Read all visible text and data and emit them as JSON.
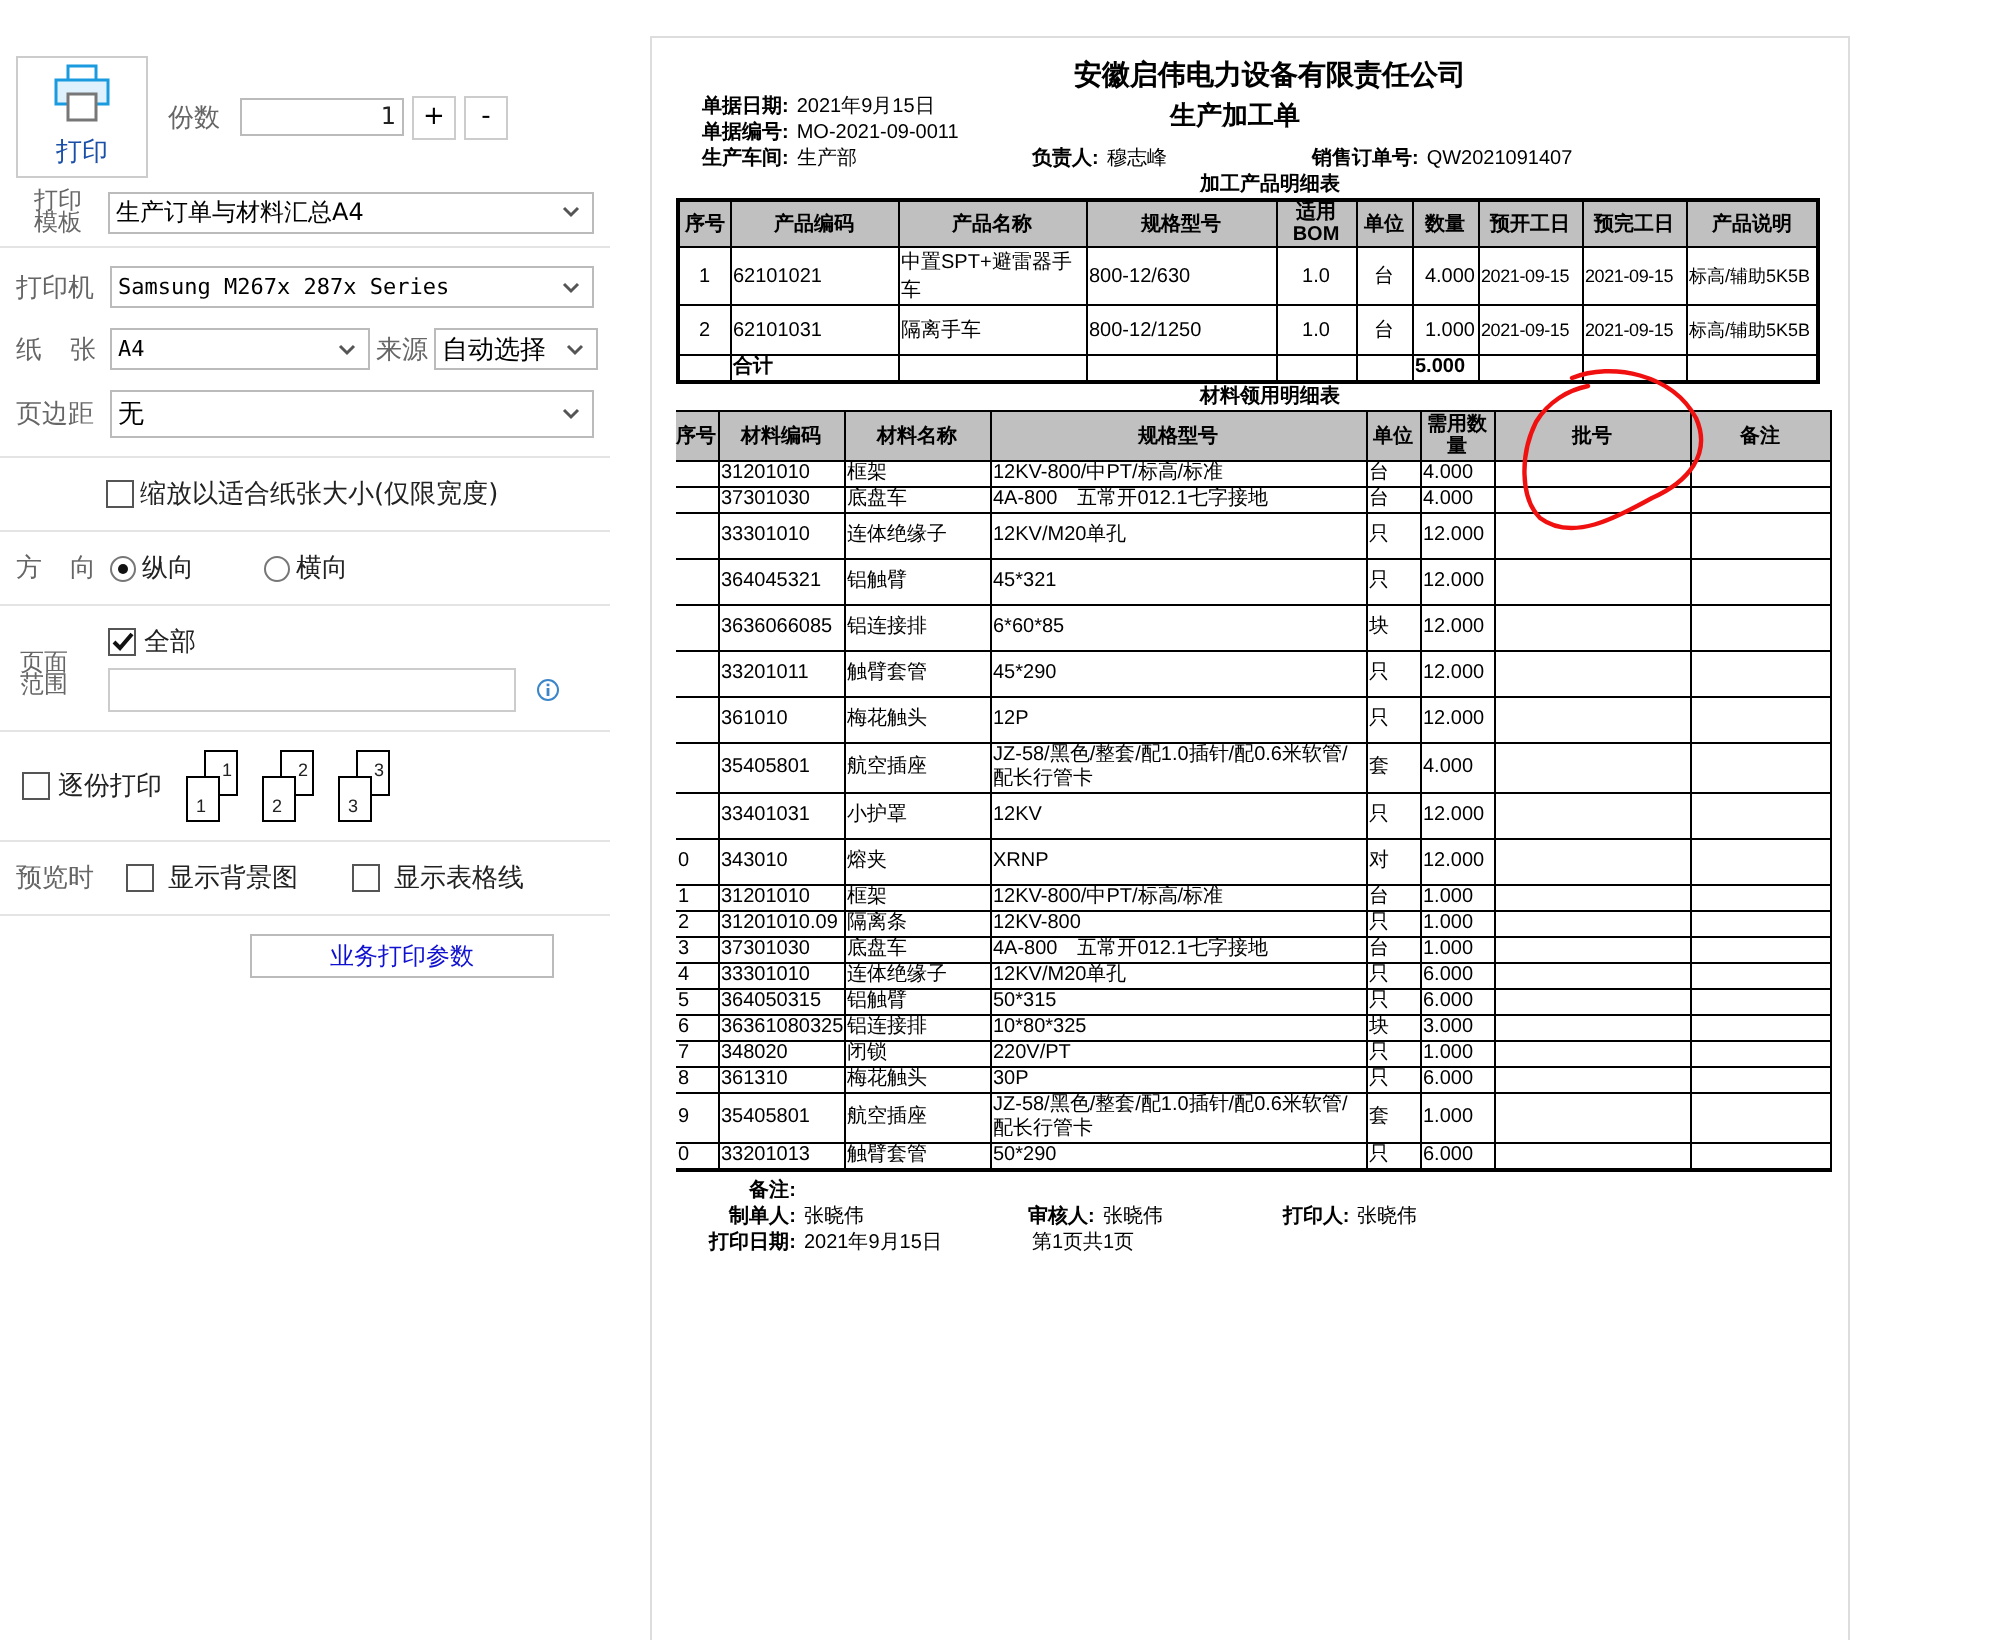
{
  "left_panel": {
    "print_button": {
      "label": "打印"
    },
    "copies": {
      "label": "份数",
      "value": "1",
      "plus": "+",
      "minus": "-"
    },
    "template": {
      "label": "打印模板",
      "value": "生产订单与材料汇总A4"
    },
    "printer": {
      "label": "打印机",
      "value": "Samsung M267x 287x Series"
    },
    "paper": {
      "label": "纸 张",
      "value": "A4",
      "source_label": "来源",
      "source_value": "自动选择"
    },
    "margin": {
      "label": "页边距",
      "value": "无"
    },
    "fit": {
      "label": "缩放以适合纸张大小(仅限宽度)",
      "checked": false
    },
    "orientation": {
      "label": "方 向",
      "options": [
        {
          "label": "纵向",
          "selected": true
        },
        {
          "label": "横向",
          "selected": false
        }
      ]
    },
    "page_range": {
      "label": "页面范围",
      "all": {
        "label": "全部",
        "checked": true
      }
    },
    "collate": {
      "label": "逐份打印",
      "checked": false,
      "stacks": [
        {
          "back": "1",
          "front": "1"
        },
        {
          "back": "2",
          "front": "2"
        },
        {
          "back": "3",
          "front": "3"
        }
      ]
    },
    "preview": {
      "label": "预览时",
      "options": [
        {
          "label": "显示背景图",
          "checked": false
        },
        {
          "label": "显示表格线",
          "checked": false
        }
      ]
    },
    "params_button": "业务打印参数"
  },
  "document": {
    "company": "安徽启伟电力设备有限责任公司",
    "title": "生产加工单",
    "info": [
      {
        "label": "单据日期:",
        "value": "2021年9月15日"
      },
      {
        "label": "单据编号:",
        "value": "MO-2021-09-0011"
      },
      {
        "label": "生产车间:",
        "value": "生产部"
      },
      {
        "label": "负责人:",
        "value": "穆志峰"
      },
      {
        "label": "销售订单号:",
        "value": "QW2021091407"
      }
    ],
    "product_table": {
      "title": "加工产品明细表",
      "columns": [
        "序号",
        "产品编码",
        "产品名称",
        "规格型号",
        "适用BOM",
        "单位",
        "数量",
        "预开工日",
        "预完工日",
        "产品说明"
      ],
      "rows": [
        [
          "1",
          "62101021",
          "中置SPT+避雷器手车",
          "800-12/630",
          "1.0",
          "台",
          "4.000",
          "2021-09-15",
          "2021-09-15",
          "标高/辅助5K5B"
        ],
        [
          "2",
          "62101031",
          "隔离手车",
          "800-12/1250",
          "1.0",
          "台",
          "1.000",
          "2021-09-15",
          "2021-09-15",
          "标高/辅助5K5B"
        ]
      ],
      "total": {
        "label": "合计",
        "quantity": "5.000"
      }
    },
    "material_table": {
      "title": "材料领用明细表",
      "columns": [
        "序号",
        "材料编码",
        "材料名称",
        "规格型号",
        "单位",
        "需用数量",
        "批号",
        "备注"
      ],
      "rows": [
        {
          "code": "31201010",
          "name": "框架",
          "spec": "12KV-800/中PT/标高/标准",
          "unit": "台",
          "qty": "4.000"
        },
        {
          "code": "37301030",
          "name": "底盘车",
          "spec": "4A-800　五常开012.1七字接地",
          "unit": "台",
          "qty": "4.000"
        },
        {
          "code": "33301010",
          "name": "连体绝缘子",
          "spec": "12KV/M20单孔",
          "unit": "只",
          "qty": "12.000"
        },
        {
          "code": "364045321",
          "name": "铝触臂",
          "spec": "45*321",
          "unit": "只",
          "qty": "12.000"
        },
        {
          "code": "3636066085",
          "name": "铝连接排",
          "spec": "6*60*85",
          "unit": "块",
          "qty": "12.000"
        },
        {
          "code": "33201011",
          "name": "触臂套管",
          "spec": "45*290",
          "unit": "只",
          "qty": "12.000"
        },
        {
          "code": "361010",
          "name": "梅花触头",
          "spec": "12P",
          "unit": "只",
          "qty": "12.000"
        },
        {
          "code": "35405801",
          "name": "航空插座",
          "spec": "JZ-58/黑色/整套/配1.0插针/配0.6米软管/配长行管卡",
          "unit": "套",
          "qty": "4.000"
        },
        {
          "code": "33401031",
          "name": "小护罩",
          "spec": "12KV",
          "unit": "只",
          "qty": "12.000"
        },
        {
          "seq": "0",
          "code": "343010",
          "name": "熔夹",
          "spec": "XRNP",
          "unit": "对",
          "qty": "12.000"
        },
        {
          "seq": "1",
          "code": "31201010",
          "name": "框架",
          "spec": "12KV-800/中PT/标高/标准",
          "unit": "台",
          "qty": "1.000"
        },
        {
          "seq": "2",
          "code": "31201010.09",
          "name": "隔离条",
          "spec": "12KV-800",
          "unit": "只",
          "qty": "1.000"
        },
        {
          "seq": "3",
          "code": "37301030",
          "name": "底盘车",
          "spec": "4A-800　五常开012.1七字接地",
          "unit": "台",
          "qty": "1.000"
        },
        {
          "seq": "4",
          "code": "33301010",
          "name": "连体绝缘子",
          "spec": "12KV/M20单孔",
          "unit": "只",
          "qty": "6.000"
        },
        {
          "seq": "5",
          "code": "364050315",
          "name": "铝触臂",
          "spec": "50*315",
          "unit": "只",
          "qty": "6.000"
        },
        {
          "seq": "6",
          "code": "36361080325",
          "name": "铝连接排",
          "spec": "10*80*325",
          "unit": "块",
          "qty": "3.000"
        },
        {
          "seq": "7",
          "code": "348020",
          "name": "闭锁",
          "spec": "220V/PT",
          "unit": "只",
          "qty": "1.000"
        },
        {
          "seq": "8",
          "code": "361310",
          "name": "梅花触头",
          "spec": "30P",
          "unit": "只",
          "qty": "6.000"
        },
        {
          "seq": "9",
          "code": "35405801",
          "name": "航空插座",
          "spec": "JZ-58/黑色/整套/配1.0插针/配0.6米软管/配长行管卡",
          "unit": "套",
          "qty": "1.000"
        },
        {
          "seq": "0",
          "code": "33201013",
          "name": "触臂套管",
          "spec": "50*290",
          "unit": "只",
          "qty": "6.000"
        }
      ]
    },
    "footer": {
      "remark_label": "备注:",
      "maker": {
        "label": "制单人:",
        "value": "张晓伟"
      },
      "reviewer": {
        "label": "审核人:",
        "value": "张晓伟"
      },
      "printer": {
        "label": "打印人:",
        "value": "张晓伟"
      },
      "print_date": {
        "label": "打印日期:",
        "value": "2021年9月15日"
      },
      "page": "第1页共1页"
    }
  }
}
